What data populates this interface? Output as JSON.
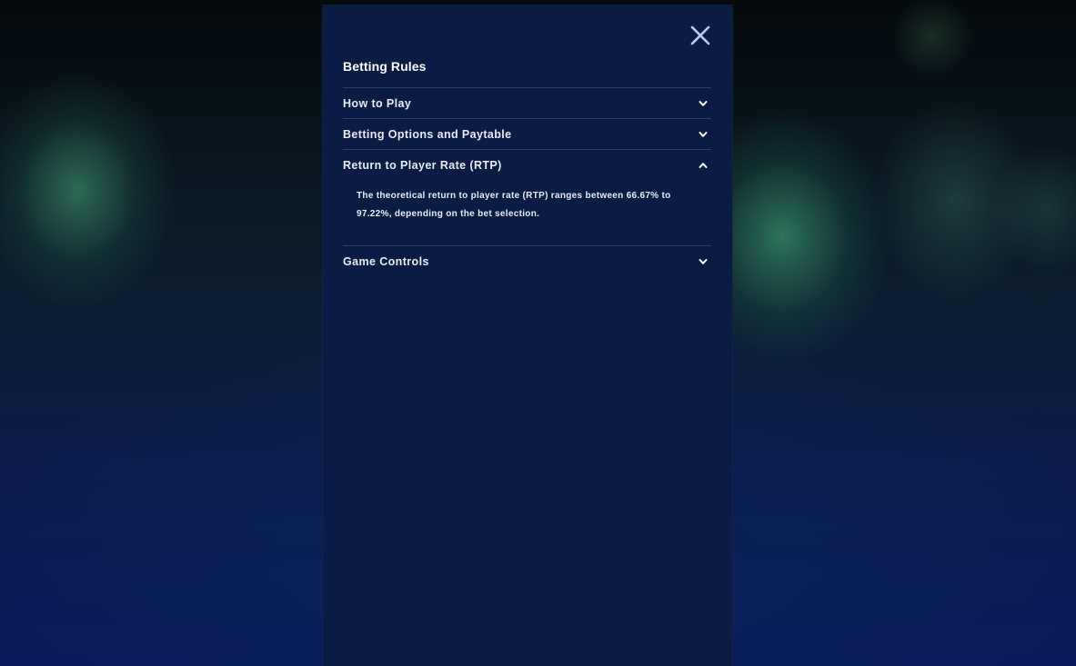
{
  "panel": {
    "title": "Betting Rules",
    "close_icon": "close-icon"
  },
  "sections": [
    {
      "label": "How to Play",
      "expanded": false,
      "icon": "chevron-down-icon"
    },
    {
      "label": "Betting Options and Paytable",
      "expanded": false,
      "icon": "chevron-down-icon"
    },
    {
      "label": "Return to Player Rate (RTP)",
      "expanded": true,
      "icon": "chevron-up-icon",
      "body": "The theoretical return to player rate (RTP) ranges between 66.67% to 97.22%, depending on the bet selection."
    },
    {
      "label": "Game Controls",
      "expanded": false,
      "icon": "chevron-down-icon"
    }
  ],
  "colors": {
    "panel_bg": "#0b1c44",
    "divider": "#24406e",
    "text": "#e6ebf5",
    "close_icon": "#b9cdf0"
  }
}
